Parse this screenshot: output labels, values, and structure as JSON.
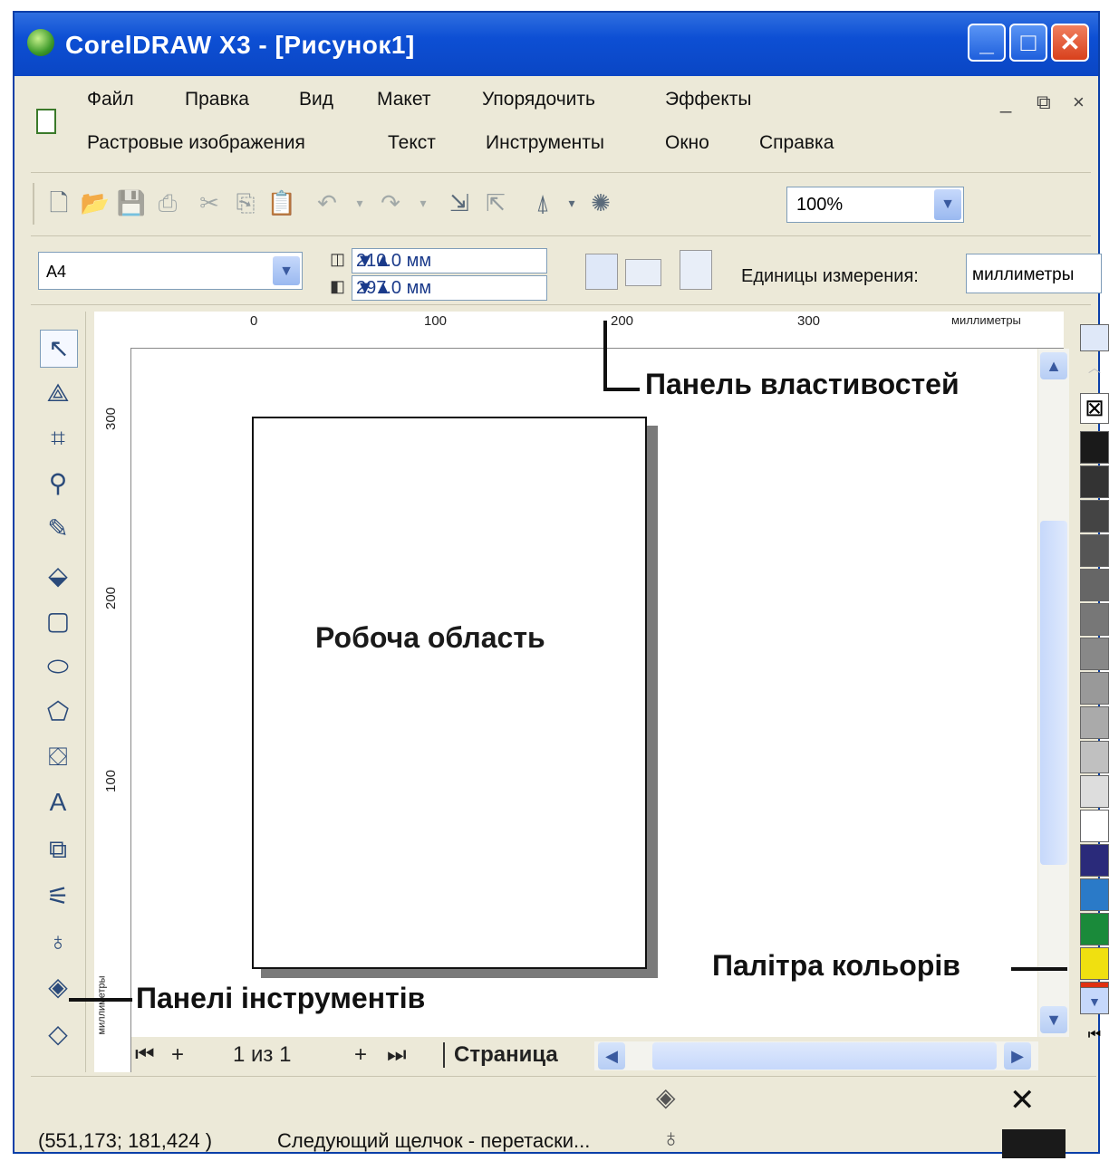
{
  "window": {
    "title": "CorelDRAW X3 - [Рисунок1]",
    "buttons": {
      "minimize": "_",
      "maximize": "□",
      "close": "✕"
    }
  },
  "menu": {
    "row1": [
      "Файл",
      "Правка",
      "Вид",
      "Макет",
      "Упорядочить",
      "Эффекты"
    ],
    "row2": [
      "Растровые изображения",
      "Текст",
      "Инструменты",
      "Окно",
      "Справка"
    ],
    "doc_controls": [
      "_",
      "⧉",
      "×"
    ]
  },
  "toolbar": {
    "zoom_value": "100%",
    "icons": [
      "new-icon",
      "open-icon",
      "save-icon",
      "print-icon",
      "cut-icon",
      "copy-icon",
      "paste-icon",
      "undo-icon",
      "redo-icon",
      "import-icon",
      "export-icon",
      "application-launcher-icon",
      "welcome-screen-icon"
    ]
  },
  "property_bar": {
    "paper_size": "A4",
    "width": "210.0 мм",
    "height": "297.0 мм",
    "units_label": "Единицы измерения:",
    "units_value": "миллиметры"
  },
  "rulers": {
    "horizontal_labels": [
      "0",
      "100",
      "200",
      "300"
    ],
    "horizontal_units": "миллиметры",
    "vertical_labels": [
      "300",
      "200",
      "100"
    ],
    "vertical_units": "миллиметры"
  },
  "canvas": {
    "work_area_label": "Робоча область"
  },
  "callouts": {
    "property_bar": "Панель властивостей",
    "color_palette": "Палітра кольорів",
    "toolbox": "Панелі інструментів"
  },
  "page_nav": {
    "counter": "1 из 1",
    "tab": "Страница"
  },
  "status": {
    "coordinates": "(551,173; 181,424 )",
    "hint": "Следующий щелчок - перетаски..."
  },
  "palette": {
    "colors": [
      "#1a1a1a",
      "#333333",
      "#444444",
      "#555555",
      "#666666",
      "#777777",
      "#888888",
      "#999999",
      "#aaaaaa",
      "#c0c0c0",
      "#dddddd",
      "#ffffff",
      "#2a2a7a",
      "#2a7ac8",
      "#1a8a3a",
      "#f0e010",
      "#e03010"
    ]
  }
}
